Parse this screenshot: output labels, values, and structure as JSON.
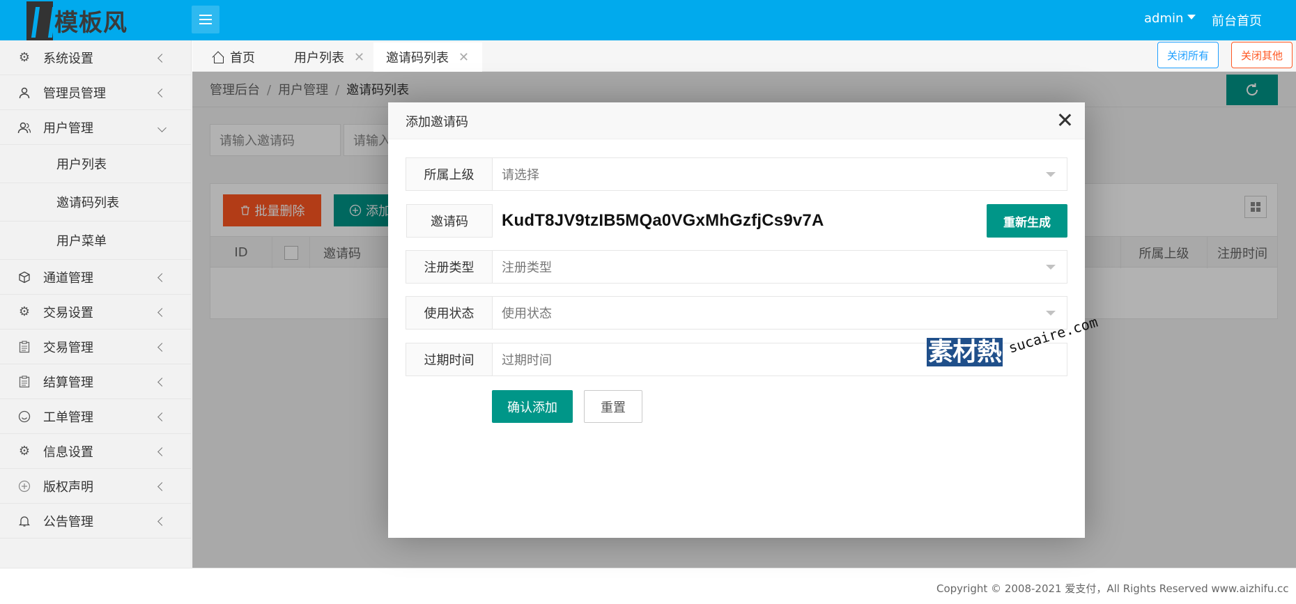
{
  "header": {
    "logo_text": "模板风",
    "user_label": "admin",
    "front_home": "前台首页",
    "accent_color": "#01aaed"
  },
  "sidebar": {
    "items": [
      {
        "label": "系统设置",
        "icon": "gear-icon"
      },
      {
        "label": "管理员管理",
        "icon": "user-icon"
      },
      {
        "label": "用户管理",
        "icon": "users-icon",
        "expanded": true,
        "children": [
          {
            "label": "用户列表"
          },
          {
            "label": "邀请码列表"
          },
          {
            "label": "用户菜单"
          }
        ]
      },
      {
        "label": "通道管理",
        "icon": "cube-icon"
      },
      {
        "label": "交易设置",
        "icon": "gear-icon"
      },
      {
        "label": "交易管理",
        "icon": "clipboard-icon"
      },
      {
        "label": "结算管理",
        "icon": "clipboard-icon"
      },
      {
        "label": "工单管理",
        "icon": "smile-icon"
      },
      {
        "label": "信息设置",
        "icon": "gear-icon"
      },
      {
        "label": "版权声明",
        "icon": "plus-circle-icon"
      },
      {
        "label": "公告管理",
        "icon": "bell-icon"
      }
    ]
  },
  "tabs": [
    {
      "label": "首页",
      "closable": false
    },
    {
      "label": "用户列表",
      "closable": true
    },
    {
      "label": "邀请码列表",
      "closable": true,
      "active": true
    }
  ],
  "tab_actions": {
    "close_all": "关闭所有",
    "close_other": "关闭其他"
  },
  "breadcrumb": [
    "管理后台",
    "用户管理",
    "邀请码列表"
  ],
  "search": {
    "code_placeholder": "请输入邀请码",
    "second_placeholder": "请输入"
  },
  "toolbar": {
    "batch_delete": "批量删除",
    "add": "添加"
  },
  "table": {
    "columns": [
      "ID",
      "",
      "邀请码",
      "所属上级",
      "注册时间"
    ]
  },
  "modal": {
    "title": "添加邀请码",
    "fields": {
      "parent_label": "所属上级",
      "parent_placeholder": "请选择",
      "code_label": "邀请码",
      "code_value": "KudT8JV9tzIB5MQa0VGxMhGzfjCs9v7A",
      "regen_button": "重新生成",
      "reg_type_label": "注册类型",
      "reg_type_placeholder": "注册类型",
      "status_label": "使用状态",
      "status_placeholder": "使用状态",
      "expire_label": "过期时间",
      "expire_placeholder": "过期时间"
    },
    "confirm_button": "确认添加",
    "reset_button": "重置"
  },
  "watermark": {
    "mark": "素材熱",
    "url": "sucaire.com"
  },
  "footer": {
    "copyright": "Copyright © 2008-2021 爱支付，All Rights Reserved www.aizhifu.cc"
  },
  "colors": {
    "primary": "#009688",
    "danger": "#ff5722",
    "info": "#1e9fff"
  }
}
